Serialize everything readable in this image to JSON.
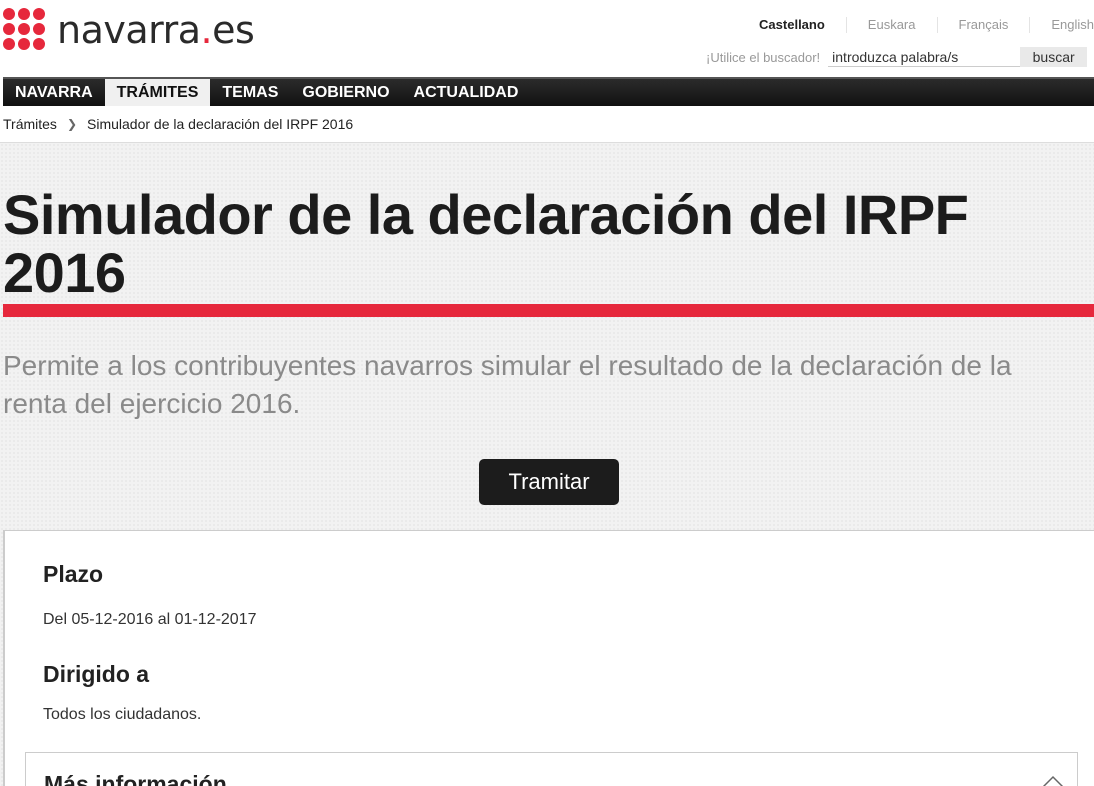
{
  "logo": {
    "name": "navarra",
    "dot": ".",
    "suffix": "es"
  },
  "languages": [
    {
      "label": "Castellano",
      "active": true
    },
    {
      "label": "Euskara",
      "active": false
    },
    {
      "label": "Français",
      "active": false
    },
    {
      "label": "English",
      "active": false
    }
  ],
  "search": {
    "hint": "¡Utilice el buscador!",
    "value": "introduzca palabra/s",
    "button": "buscar"
  },
  "nav": [
    {
      "label": "NAVARRA",
      "active": false
    },
    {
      "label": "TRÁMITES",
      "active": true
    },
    {
      "label": "TEMAS",
      "active": false
    },
    {
      "label": "GOBIERNO",
      "active": false
    },
    {
      "label": "ACTUALIDAD",
      "active": false
    }
  ],
  "breadcrumb": {
    "parent": "Trámites",
    "current": "Simulador de la declaración del IRPF 2016"
  },
  "page": {
    "title": "Simulador de la declaración del IRPF 2016",
    "subtitle": "Permite a los contribuyentes navarros simular el resultado de la declaración de la renta del ejercicio 2016.",
    "action": "Tramitar"
  },
  "details": {
    "plazo_heading": "Plazo",
    "plazo_text": "Del 05-12-2016 al 01-12-2017",
    "dirigido_heading": "Dirigido a",
    "dirigido_text": "Todos los ciudadanos.",
    "more_heading": "Más información"
  },
  "colors": {
    "accent": "#e6283c",
    "nav_bg": "#1c1c1c"
  }
}
